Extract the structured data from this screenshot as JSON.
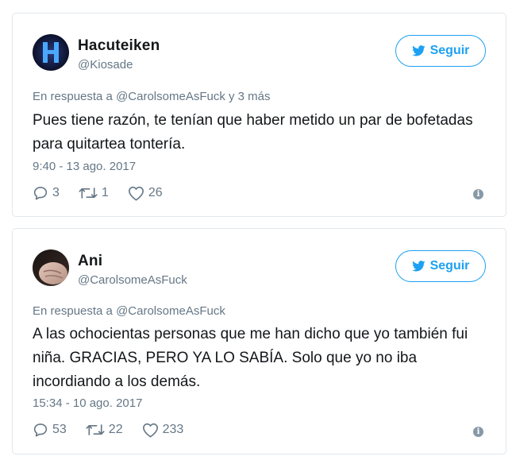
{
  "tweets": [
    {
      "display_name": "Hacuteiken",
      "handle": "@Kiosade",
      "follow_label": "Seguir",
      "reply_context": "En respuesta a @CarolsomeAsFuck y 3 más",
      "text": "Pues tiene razón, te tenían que haber metido un par de bofetadas para quitartea tontería.",
      "timestamp": "9:40 - 13 ago. 2017",
      "replies": "3",
      "retweets": "1",
      "likes": "26"
    },
    {
      "display_name": "Ani",
      "handle": "@CarolsomeAsFuck",
      "follow_label": "Seguir",
      "reply_context": "En respuesta a @CarolsomeAsFuck",
      "text": "A las ochocientas personas que me han dicho que yo también fui niña. GRACIAS, PERO YA LO SABÍA. Solo que yo no iba incordiando a los demás.",
      "timestamp": "15:34 - 10 ago. 2017",
      "replies": "53",
      "retweets": "22",
      "likes": "233"
    }
  ],
  "colors": {
    "accent": "#1da1f2",
    "secondary_text": "#657786",
    "border": "#e1e8ed"
  },
  "icons": [
    "twitter-bird-icon",
    "reply-icon",
    "retweet-icon",
    "heart-icon",
    "info-icon"
  ]
}
